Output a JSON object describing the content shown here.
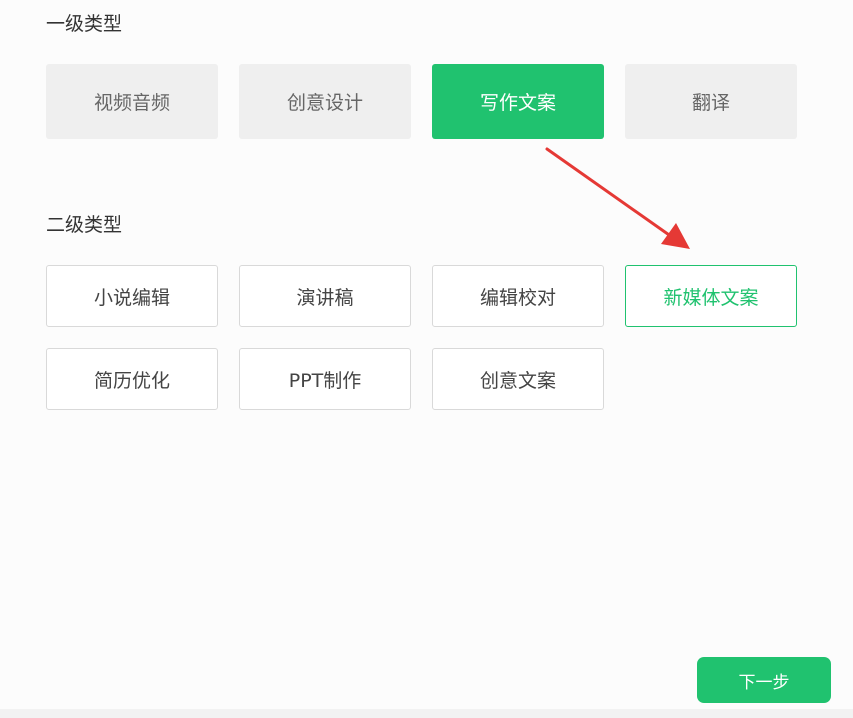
{
  "primary": {
    "title": "一级类型",
    "options": [
      {
        "label": "视频音频"
      },
      {
        "label": "创意设计"
      },
      {
        "label": "写作文案"
      },
      {
        "label": "翻译"
      }
    ],
    "selected": "写作文案"
  },
  "secondary": {
    "title": "二级类型",
    "options": [
      {
        "label": "小说编辑"
      },
      {
        "label": "演讲稿"
      },
      {
        "label": "编辑校对"
      },
      {
        "label": "新媒体文案"
      },
      {
        "label": "简历优化"
      },
      {
        "label": "PPT制作"
      },
      {
        "label": "创意文案"
      }
    ],
    "selected": "新媒体文案"
  },
  "next_label": "下一步",
  "colors": {
    "accent": "#20c26f",
    "arrow": "#e53935"
  }
}
